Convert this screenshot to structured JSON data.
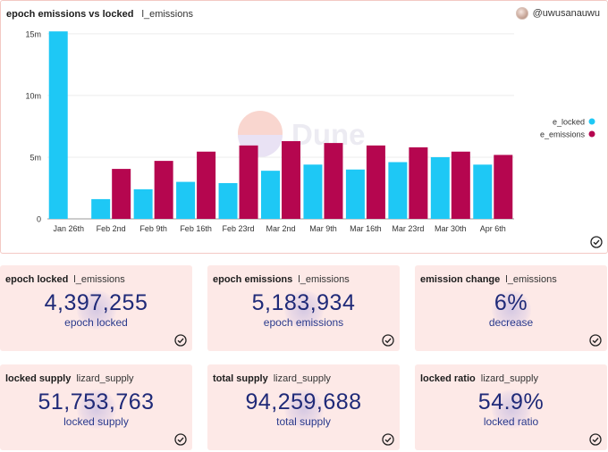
{
  "chart_panel": {
    "title": "epoch emissions vs locked",
    "query": "l_emissions",
    "user": "@uwusanauwu",
    "watermark": "Dune"
  },
  "chart_data": {
    "type": "bar",
    "categories": [
      "Jan 26th",
      "Feb 2nd",
      "Feb 9th",
      "Feb 16th",
      "Feb 23rd",
      "Mar 2nd",
      "Mar 9th",
      "Mar 16th",
      "Mar 23rd",
      "Mar 30th",
      "Apr 6th"
    ],
    "ytick_labels": [
      "0",
      "5m",
      "10m",
      "15m"
    ],
    "ylim": [
      0,
      15500000
    ],
    "yticks": [
      0,
      5000000,
      10000000,
      15000000
    ],
    "series": [
      {
        "name": "e_locked",
        "color": "#1ec8f5",
        "values": [
          15200000,
          1600000,
          2400000,
          3000000,
          2900000,
          3900000,
          4400000,
          4000000,
          4600000,
          5000000,
          4397255
        ]
      },
      {
        "name": "e_emissions",
        "color": "#b5064f",
        "values": [
          0,
          4050000,
          4700000,
          5450000,
          5950000,
          6300000,
          6150000,
          5950000,
          5800000,
          5450000,
          5183934
        ]
      }
    ],
    "legend_position": "right",
    "grid": "horizontal"
  },
  "cards": [
    {
      "title": "epoch locked",
      "query": "l_emissions",
      "value": "4,397,255",
      "subtitle": "epoch locked"
    },
    {
      "title": "epoch emissions",
      "query": "l_emissions",
      "value": "5,183,934",
      "subtitle": "epoch emissions"
    },
    {
      "title": "emission change",
      "query": "l_emissions",
      "value": "6%",
      "subtitle": "decrease"
    },
    {
      "title": "locked supply",
      "query": "lizard_supply",
      "value": "51,753,763",
      "subtitle": "locked supply"
    },
    {
      "title": "total supply",
      "query": "lizard_supply",
      "value": "94,259,688",
      "subtitle": "total supply"
    },
    {
      "title": "locked ratio",
      "query": "lizard_supply",
      "value": "54.9%",
      "subtitle": "locked ratio"
    }
  ]
}
